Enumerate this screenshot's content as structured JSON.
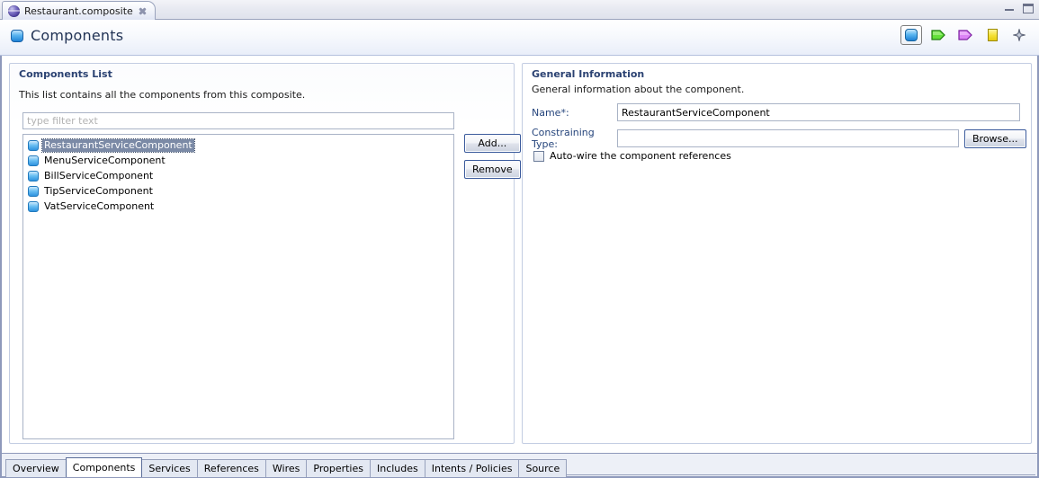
{
  "window": {
    "editor_tab": {
      "title": "Restaurant.composite",
      "icon": "globe-icon",
      "close_icon": "close-icon"
    },
    "buttons": {
      "minimize": "minimize-button",
      "maximize": "maximize-button"
    }
  },
  "form_header": {
    "title": "Components",
    "icon": "component-icon",
    "tools": [
      {
        "name": "component-tool",
        "icon": "blue-rounded-square-icon",
        "selected": true
      },
      {
        "name": "service-tool",
        "icon": "green-pennant-icon",
        "selected": false
      },
      {
        "name": "reference-tool",
        "icon": "purple-pennant-icon",
        "selected": false
      },
      {
        "name": "property-tool",
        "icon": "yellow-square-icon",
        "selected": false
      },
      {
        "name": "intent-tool",
        "icon": "four-point-star-icon",
        "selected": false
      }
    ]
  },
  "left_panel": {
    "title": "Components List",
    "description": "This list contains all the components from this composite.",
    "filter_placeholder": "type filter text",
    "filter_value": "",
    "items": [
      {
        "label": "RestaurantServiceComponent",
        "selected": true
      },
      {
        "label": "MenuServiceComponent",
        "selected": false
      },
      {
        "label": "BillServiceComponent",
        "selected": false
      },
      {
        "label": "TipServiceComponent",
        "selected": false
      },
      {
        "label": "VatServiceComponent",
        "selected": false
      }
    ],
    "add_button": "Add...",
    "remove_button": "Remove"
  },
  "right_panel": {
    "title": "General Information",
    "description": "General information about the component.",
    "name_label": "Name*:",
    "name_value": "RestaurantServiceComponent",
    "constraining_type_label": "Constraining Type:",
    "constraining_type_value": "",
    "browse_button": "Browse...",
    "autowire_label": "Auto-wire the component references",
    "autowire_checked": false
  },
  "bottom_tabs": [
    {
      "label": "Overview",
      "active": false
    },
    {
      "label": "Components",
      "active": true
    },
    {
      "label": "Services",
      "active": false
    },
    {
      "label": "References",
      "active": false
    },
    {
      "label": "Wires",
      "active": false
    },
    {
      "label": "Properties",
      "active": false
    },
    {
      "label": "Includes",
      "active": false
    },
    {
      "label": "Intents / Policies",
      "active": false
    },
    {
      "label": "Source",
      "active": false
    }
  ],
  "colors": {
    "accent_blue": "#2b4272",
    "selection": "#7b8aa6",
    "panel_border": "#c3cde2",
    "window_border": "#8e99bb",
    "component_icon": "#2f93de",
    "service_icon": "#57d12a",
    "reference_icon": "#d16ef0",
    "property_icon": "#f4e033"
  }
}
